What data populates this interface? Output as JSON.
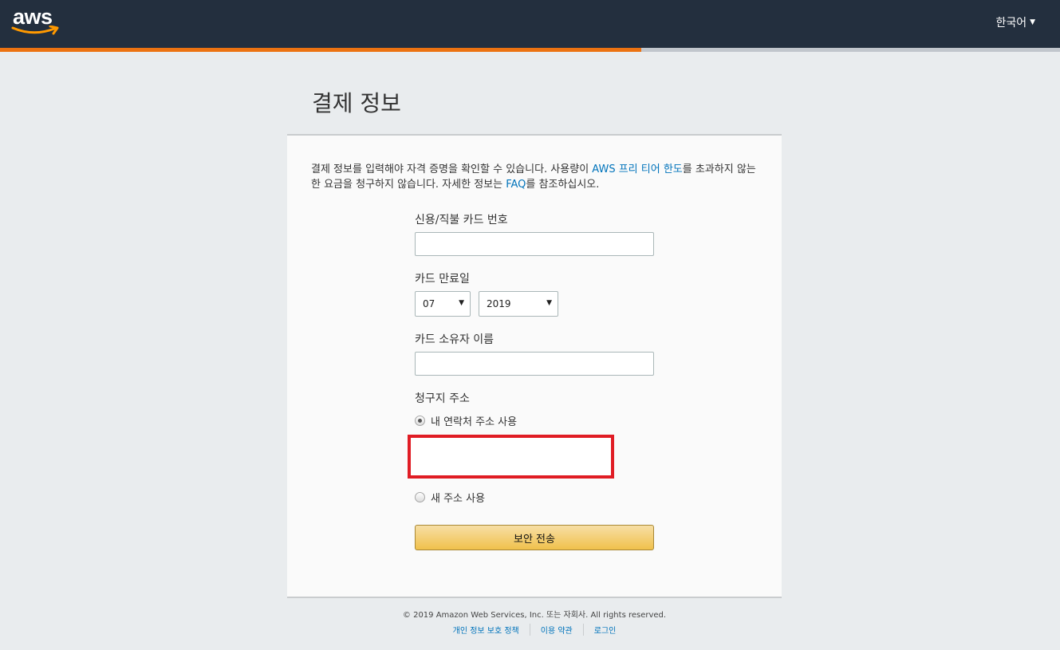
{
  "header": {
    "logo_text": "aws",
    "language": "한국어",
    "progress_fraction": 0.605
  },
  "page": {
    "title": "결제 정보"
  },
  "intro": {
    "part1": "결제 정보를 입력해야 자격 증명을 확인할 수 있습니다. 사용량이 ",
    "link1": "AWS 프리 티어 한도",
    "part2": "를 초과하지 않는 한 요금을 청구하지 않습니다. 자세한 정보는 ",
    "link2": "FAQ",
    "part3": "를 참조하십시오."
  },
  "form": {
    "card_number_label": "신용/직불 카드 번호",
    "card_number_value": "",
    "expiry_label": "카드 만료일",
    "expiry_month": "07",
    "expiry_year": "2019",
    "holder_label": "카드 소유자 이름",
    "holder_value": "",
    "billing_label": "청구지 주소",
    "use_contact_address": "내 연락처 주소 사용",
    "use_new_address": "새 주소 사용",
    "submit_label": "보안 전송"
  },
  "footer": {
    "copyright": "© 2019 Amazon Web Services, Inc. 또는 자회사. All rights reserved.",
    "links": [
      "개인 정보 보호 정책",
      "이용 약관",
      "로그인"
    ]
  },
  "colors": {
    "header_bg": "#232f3e",
    "progress_fill": "#ec7211",
    "link": "#0073bb",
    "highlight_box": "#e01c24",
    "submit_button": "#f0c14b"
  }
}
